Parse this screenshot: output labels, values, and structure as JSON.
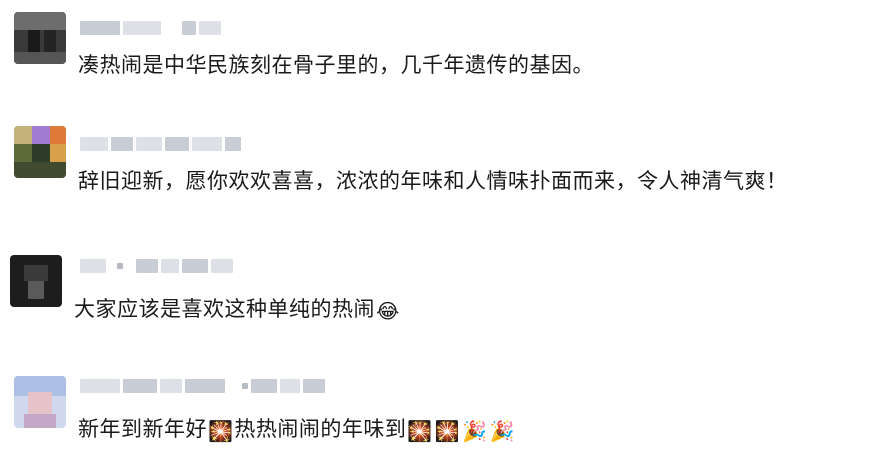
{
  "comments": [
    {
      "text_parts": [
        "凑热闹是中华民族刻在骨子里的，几千年遗传的基因。"
      ],
      "emojis": []
    },
    {
      "text_parts": [
        "辞旧迎新，愿你欢欢喜喜，浓浓的年味和人情味扑面而来，令人神清气爽！"
      ],
      "emojis": []
    },
    {
      "text_parts": [
        "大家应该是喜欢这种单纯的热闹"
      ],
      "emojis": [
        "😂"
      ]
    },
    {
      "text_parts": [
        "新年到新年好",
        "热热闹闹的年味到"
      ],
      "emojis": [
        "🎇",
        "🎇",
        "🎇",
        "🎉",
        "🎉"
      ]
    }
  ]
}
